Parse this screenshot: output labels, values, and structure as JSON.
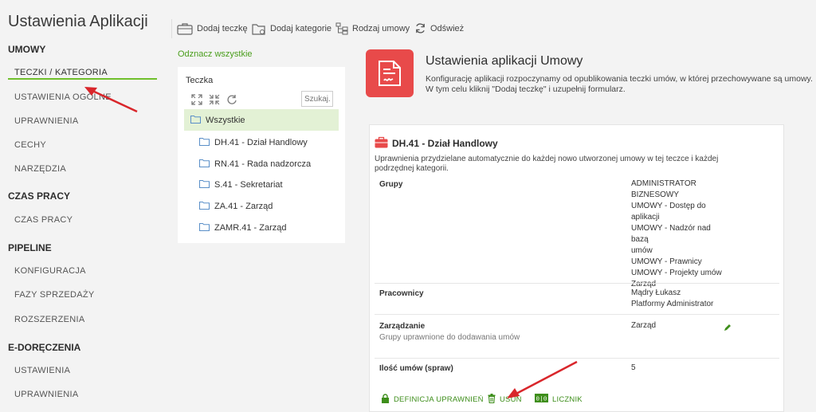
{
  "app_title": "Ustawienia Aplikacji",
  "sidebar": {
    "sections": [
      {
        "label": "UMOWY",
        "items": [
          "TECZKI / KATEGORIA",
          "USTAWIENIA OGÓLNE",
          "UPRAWNIENIA",
          "CECHY",
          "NARZĘDZIA"
        ]
      },
      {
        "label": "CZAS PRACY",
        "items": [
          "CZAS PRACY"
        ]
      },
      {
        "label": "PIPELINE",
        "items": [
          "KONFIGURACJA",
          "FAZY SPRZEDAŻY",
          "ROZSZERZENIA"
        ]
      },
      {
        "label": "E-DORĘCZENIA",
        "items": [
          "USTAWIENIA",
          "UPRAWNIENIA"
        ]
      }
    ]
  },
  "toolbar": {
    "add_folder": "Dodaj teczkę",
    "add_category": "Dodaj kategorie",
    "contract_type": "Rodzaj umowy",
    "refresh": "Odśwież"
  },
  "mark_all": "Odznacz wszystkie",
  "tree": {
    "title": "Teczka",
    "search_placeholder": "Szukaj...",
    "root": "Wszystkie",
    "nodes": [
      "DH.41 - Dział Handlowy",
      "RN.41 - Rada nadzorcza",
      "S.41 - Sekretariat",
      "ZA.41 - Zarząd",
      "ZAMR.41 - Zarząd"
    ]
  },
  "header": {
    "title": "Ustawienia aplikacji Umowy",
    "description": "Konfigurację aplikacji rozpoczynamy od opublikowania teczki umów, w której przechowywane są umowy. W tym celu kliknij \"Dodaj teczkę\" i uzupełnij formularz."
  },
  "card": {
    "title": "DH.41 - Dział Handlowy",
    "description": "Uprawnienia przydzielane automatycznie do każdej nowo utworzonej umowy w tej teczce i każdej podrzędnej kategorii.",
    "groups_label": "Grupy",
    "groups_value": [
      "ADMINISTRATOR",
      "BIZNESOWY",
      "UMOWY - Dostęp do",
      "aplikacji",
      "UMOWY - Nadzór nad bazą",
      "umów",
      "UMOWY - Prawnicy",
      "UMOWY - Projekty umów",
      "Zarząd"
    ],
    "employees_label": "Pracownicy",
    "employees_value": [
      "Mądry Łukasz",
      "Platformy Administrator"
    ],
    "management_label": "Zarządzanie",
    "management_sub": "Grupy uprawnione do dodawania umów",
    "management_value": "Zarząd",
    "count_label": "Ilość umów (spraw)",
    "count_value": "5",
    "actions": {
      "permissions": "DEFINICJA UPRAWNIEŃ",
      "delete": "USUŃ",
      "counter": "LICZNIK"
    }
  },
  "colors": {
    "accent_green": "#6fbf2b",
    "action_green": "#3e8e1b",
    "hero_red": "#e84a4a",
    "arrow_red": "#d9262b"
  }
}
